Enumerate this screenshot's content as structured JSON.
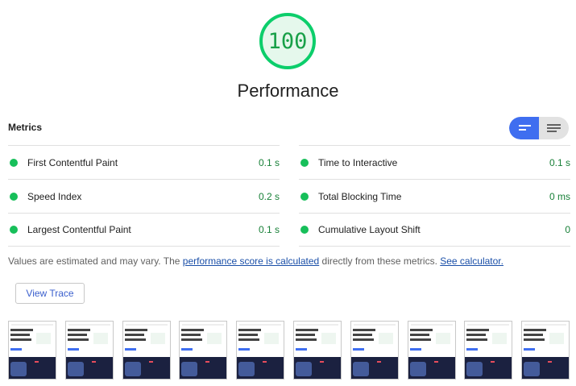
{
  "category": {
    "score": "100",
    "title": "Performance",
    "accent_color": "#0cce6b"
  },
  "metrics": {
    "heading": "Metrics",
    "toggle": {
      "active": "compact-view",
      "icons": [
        "compact-view-icon",
        "expanded-view-icon"
      ]
    },
    "left": [
      {
        "label": "First Contentful Paint",
        "value": "0.1 s"
      },
      {
        "label": "Speed Index",
        "value": "0.2 s"
      },
      {
        "label": "Largest Contentful Paint",
        "value": "0.1 s"
      }
    ],
    "right": [
      {
        "label": "Time to Interactive",
        "value": "0.1 s"
      },
      {
        "label": "Total Blocking Time",
        "value": "0 ms"
      },
      {
        "label": "Cumulative Layout Shift",
        "value": "0"
      }
    ]
  },
  "note": {
    "prefix": "Values are estimated and may vary. The ",
    "link1": "performance score is calculated",
    "middle": " directly from these metrics. ",
    "link2": "See calculator."
  },
  "view_trace_label": "View Trace",
  "filmstrip": {
    "frame_count": 10
  }
}
